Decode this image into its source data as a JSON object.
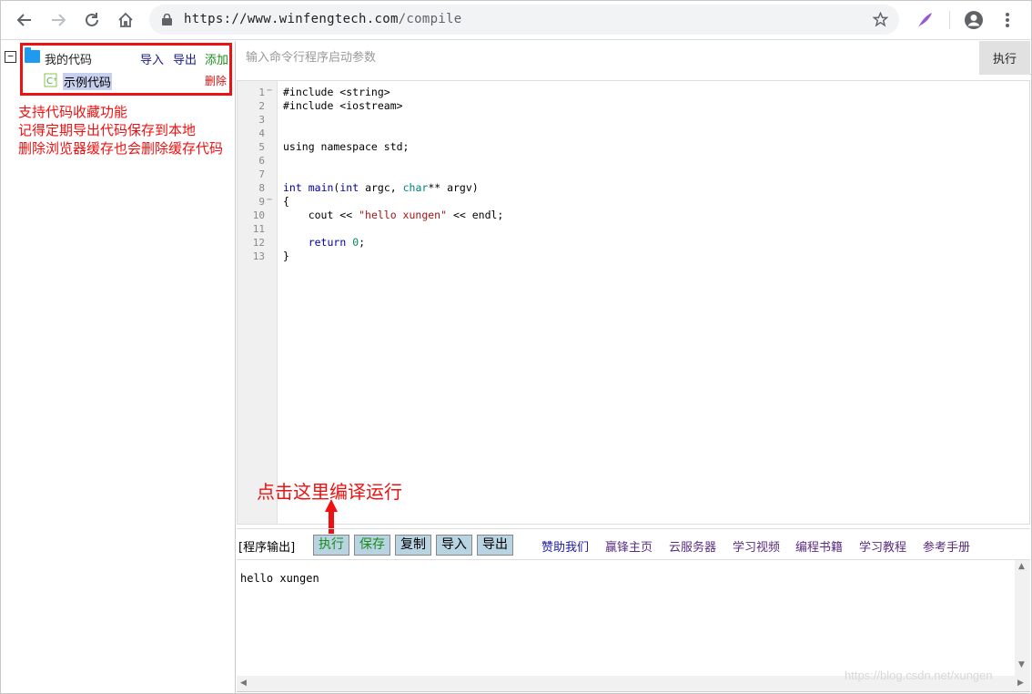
{
  "browser": {
    "url_host": "https://www.winfengtech.com",
    "url_path": "/compile"
  },
  "tree": {
    "toggle": "−",
    "root_label": "我的代码",
    "actions": {
      "import": "导入",
      "export": "导出",
      "add": "添加"
    },
    "child_label": "示例代码",
    "child_delete": "删除"
  },
  "notes": [
    "支持代码收藏功能",
    "记得定期导出代码保存到本地",
    "删除浏览器缓存也会删除缓存代码"
  ],
  "cmd": {
    "placeholder": "输入命令行程序启动参数",
    "run_label": "执行"
  },
  "editor": {
    "line_numbers": [
      "1",
      "2",
      "3",
      "4",
      "5",
      "6",
      "7",
      "8",
      "9",
      "10",
      "11",
      "12",
      "13"
    ],
    "fold_markers": {
      "1": "−",
      "9": "−"
    }
  },
  "annotation": "点击这里编译运行",
  "output_toolbar": {
    "label": "[程序输出]",
    "buttons": [
      "执行",
      "保存",
      "复制",
      "导入",
      "导出"
    ],
    "links": [
      "赞助我们",
      "赢锋主页",
      "云服务器",
      "学习视频",
      "编程书籍",
      "学习教程",
      "参考手册"
    ]
  },
  "output": {
    "text": "hello xungen"
  },
  "watermark": "https://blog.csdn.net/xungen",
  "colors": {
    "accent_red": "#ee1111",
    "folder_blue": "#1e9bf0",
    "button_bg": "#b8d4e2"
  }
}
